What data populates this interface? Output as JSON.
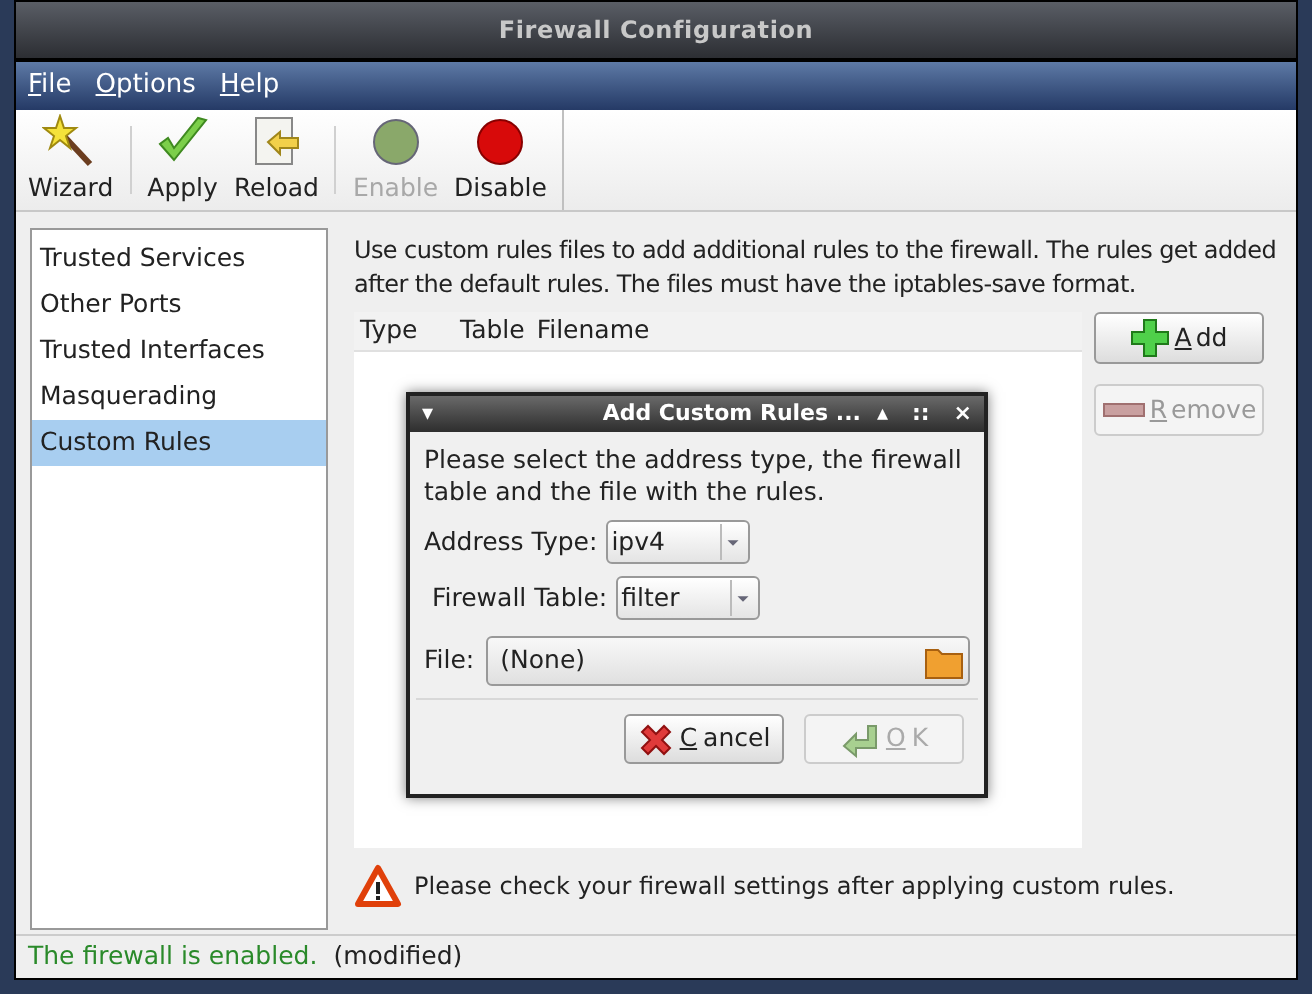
{
  "window": {
    "title": "Firewall Configuration"
  },
  "menu": [
    {
      "accel": "F",
      "rest": "ile"
    },
    {
      "accel": "O",
      "rest": "ptions"
    },
    {
      "accel": "H",
      "rest": "elp"
    }
  ],
  "toolbar": [
    {
      "kind": "wizard",
      "label": "Wizard",
      "disabled": false
    },
    {
      "kind": "apply",
      "label": "Apply",
      "disabled": false
    },
    {
      "kind": "reload",
      "label": "Reload",
      "disabled": false
    },
    {
      "kind": "enable",
      "label": "Enable",
      "disabled": true
    },
    {
      "kind": "disable",
      "label": "Disable",
      "disabled": false
    }
  ],
  "sidebar": {
    "items": [
      {
        "label": "Trusted Services",
        "selected": false
      },
      {
        "label": "Other Ports",
        "selected": false
      },
      {
        "label": "Trusted Interfaces",
        "selected": false
      },
      {
        "label": "Masquerading",
        "selected": false
      },
      {
        "label": "Custom Rules",
        "selected": true
      }
    ]
  },
  "description": "Use custom rules files to add additional rules to the firewall. The rules get added after the default rules. The files must have the iptables-save format.",
  "table": {
    "columns": [
      "Type",
      "Table",
      "Filename"
    ]
  },
  "side_buttons": [
    {
      "kind": "add",
      "accel": "A",
      "rest": "dd",
      "disabled": false
    },
    {
      "kind": "remove",
      "accel": "R",
      "rest": "emove",
      "disabled": true
    }
  ],
  "warning": "Please check your firewall settings after applying custom rules.",
  "status_bar": {
    "state": "The firewall is enabled.",
    "note": "(modified)"
  },
  "dialog": {
    "title": "Add Custom Rules ...",
    "title_buttons": [
      "▾",
      "▴",
      "::",
      "×"
    ],
    "message": "Please select the address type, the firewall table and the file with the rules.",
    "fields": [
      {
        "label": "Address Type:",
        "value": "ipv4"
      },
      {
        "label": "Firewall Table:",
        "value": "filter"
      }
    ],
    "file": {
      "label": "File:",
      "value": "(None)"
    },
    "buttons": [
      {
        "kind": "cancel",
        "accel": "C",
        "rest": "ancel",
        "disabled": false
      },
      {
        "kind": "ok",
        "accel": "O",
        "rest": "K",
        "disabled": true
      }
    ]
  }
}
